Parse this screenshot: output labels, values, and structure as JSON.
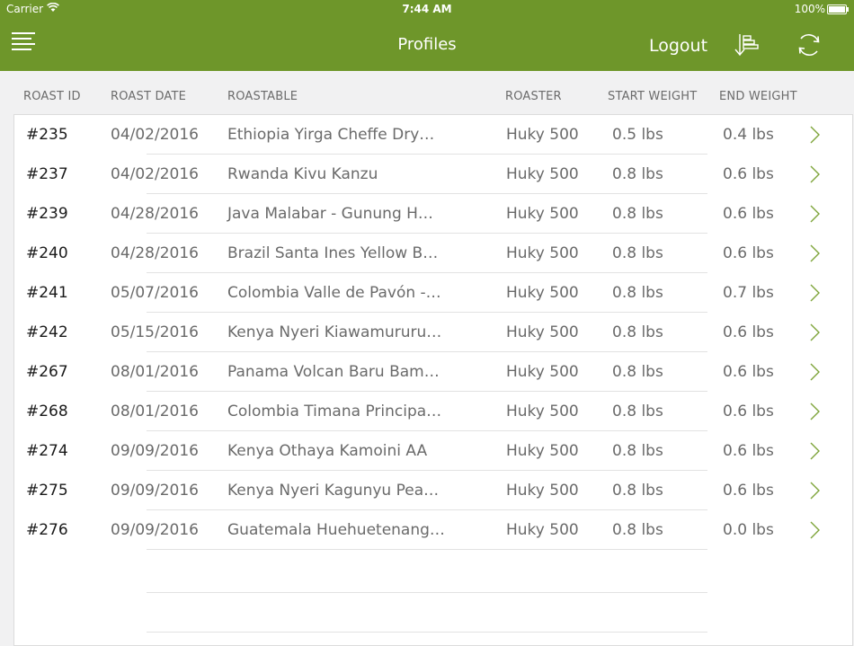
{
  "status_bar": {
    "carrier": "Carrier",
    "time": "7:44 AM",
    "battery": "100%"
  },
  "header": {
    "title": "Profiles",
    "logout_label": "Logout",
    "accent_color": "#6e962a",
    "icons": [
      "menu-icon",
      "sort-icon",
      "refresh-icon"
    ]
  },
  "columns": [
    "ROAST ID",
    "ROAST DATE",
    "ROASTABLE",
    "ROASTER",
    "START WEIGHT",
    "END WEIGHT"
  ],
  "rows": [
    {
      "id": "#235",
      "date": "04/02/2016",
      "roastable": "Ethiopia Yirga Cheffe Dry…",
      "roaster": "Huky 500",
      "start": "0.5 lbs",
      "end": "0.4 lbs"
    },
    {
      "id": "#237",
      "date": "04/02/2016",
      "roastable": "Rwanda Kivu Kanzu",
      "roaster": "Huky 500",
      "start": "0.8 lbs",
      "end": "0.6 lbs"
    },
    {
      "id": "#239",
      "date": "04/28/2016",
      "roastable": "Java Malabar - Gunung H…",
      "roaster": "Huky 500",
      "start": "0.8 lbs",
      "end": "0.6 lbs"
    },
    {
      "id": "#240",
      "date": "04/28/2016",
      "roastable": "Brazil Santa Ines Yellow B…",
      "roaster": "Huky 500",
      "start": "0.8 lbs",
      "end": "0.6 lbs"
    },
    {
      "id": "#241",
      "date": "05/07/2016",
      "roastable": "Colombia Valle de Pavón -…",
      "roaster": "Huky 500",
      "start": "0.8 lbs",
      "end": "0.7 lbs"
    },
    {
      "id": "#242",
      "date": "05/15/2016",
      "roastable": "Kenya Nyeri Kiawamururu…",
      "roaster": "Huky 500",
      "start": "0.8 lbs",
      "end": "0.6 lbs"
    },
    {
      "id": "#267",
      "date": "08/01/2016",
      "roastable": "Panama Volcan Baru Bam…",
      "roaster": "Huky 500",
      "start": "0.8 lbs",
      "end": "0.6 lbs"
    },
    {
      "id": "#268",
      "date": "08/01/2016",
      "roastable": "Colombia Timana Principa…",
      "roaster": "Huky 500",
      "start": "0.8 lbs",
      "end": "0.6 lbs"
    },
    {
      "id": "#274",
      "date": "09/09/2016",
      "roastable": "Kenya Othaya Kamoini AA",
      "roaster": "Huky 500",
      "start": "0.8 lbs",
      "end": "0.6 lbs"
    },
    {
      "id": "#275",
      "date": "09/09/2016",
      "roastable": "Kenya Nyeri Kagunyu Pea…",
      "roaster": "Huky 500",
      "start": "0.8 lbs",
      "end": "0.6 lbs"
    },
    {
      "id": "#276",
      "date": "09/09/2016",
      "roastable": "Guatemala Huehuetenang…",
      "roaster": "Huky 500",
      "start": "0.8 lbs",
      "end": "0.0 lbs"
    }
  ]
}
